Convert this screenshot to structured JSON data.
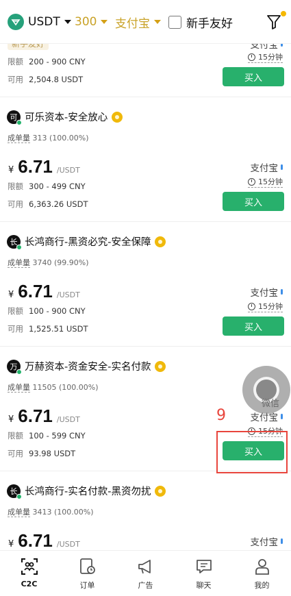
{
  "filters": {
    "coin": "USDT",
    "amount": "300",
    "payment": "支付宝",
    "newbie_label": "新手友好"
  },
  "colors": {
    "accent": "#c9a227",
    "buy": "#28b06c",
    "annotation": "#e8453c"
  },
  "cards": [
    {
      "tag": "新手友好",
      "limit_label": "限额",
      "limit": "200 - 900 CNY",
      "avail_label": "可用",
      "avail": "2,504.8 USDT",
      "pay_time": "15分钟",
      "buy_label": "买入"
    },
    {
      "avatar": "可",
      "name": "可乐资本-安全放心",
      "stats_label": "成单量",
      "stats": "313 (100.00%)",
      "currency": "¥",
      "price": "6.71",
      "unit": "/USDT",
      "pay_method": "支付宝",
      "pay_time": "15分钟",
      "limit_label": "限额",
      "limit": "300 - 499 CNY",
      "avail_label": "可用",
      "avail": "6,363.26 USDT",
      "buy_label": "买入"
    },
    {
      "avatar": "长",
      "name": "长鸿商行-黑资必究-安全保障",
      "stats_label": "成单量",
      "stats": "3740 (99.90%)",
      "currency": "¥",
      "price": "6.71",
      "unit": "/USDT",
      "pay_method": "支付宝",
      "pay_time": "15分钟",
      "limit_label": "限额",
      "limit": "100 - 900 CNY",
      "avail_label": "可用",
      "avail": "1,525.51 USDT",
      "buy_label": "买入"
    },
    {
      "avatar": "万",
      "name": "万赫资本-资金安全-实名付款",
      "stats_label": "成单量",
      "stats": "11505 (100.00%)",
      "currency": "¥",
      "price": "6.71",
      "unit": "/USDT",
      "pay_method": "支付宝",
      "pay_time": "15分钟",
      "limit_label": "限额",
      "limit": "100 - 599 CNY",
      "avail_label": "可用",
      "avail": "93.98 USDT",
      "buy_label": "买入"
    },
    {
      "avatar": "长",
      "name": "长鸿商行-实名付款-黑资勿扰",
      "stats_label": "成单量",
      "stats": "3413 (100.00%)",
      "currency": "¥",
      "price": "6.71",
      "unit": "/USDT",
      "pay_method": "支付宝"
    }
  ],
  "float": {
    "label": "微信"
  },
  "annotation": {
    "number": "9"
  },
  "nav": [
    {
      "label": "C2C",
      "icon": "c2c-icon"
    },
    {
      "label": "订单",
      "icon": "orders-icon"
    },
    {
      "label": "广告",
      "icon": "ads-icon"
    },
    {
      "label": "聊天",
      "icon": "chat-icon"
    },
    {
      "label": "我的",
      "icon": "profile-icon"
    }
  ]
}
